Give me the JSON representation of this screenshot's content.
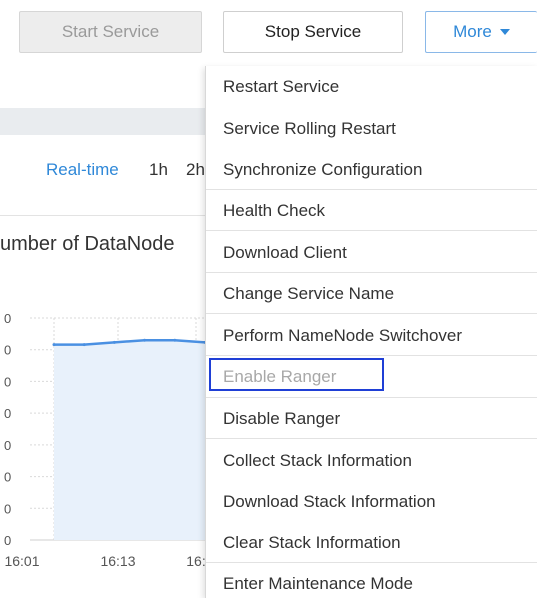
{
  "toolbar": {
    "start_label": "Start Service",
    "stop_label": "Stop Service",
    "more_label": "More"
  },
  "time_range": {
    "realtime": "Real-time",
    "h1": "1h",
    "h2": "2h"
  },
  "chart_title": "umber of DataNode",
  "chart_data": {
    "type": "area",
    "x_tick_labels": [
      "16:01",
      "16:13",
      "16:"
    ],
    "y_tick_labels": [
      "0",
      "0",
      "0",
      "0",
      "0",
      "0",
      "0",
      "0"
    ],
    "series": [
      {
        "values": [
          0.88,
          0.88,
          0.89,
          0.9,
          0.9,
          0.89
        ]
      }
    ],
    "ylim": [
      0,
      1
    ],
    "grid": true,
    "colors": {
      "line": "#4a90e2",
      "fill": "#e8f1fb"
    }
  },
  "menu": {
    "items": [
      {
        "label": "Restart Service"
      },
      {
        "label": "Service Rolling Restart"
      },
      {
        "label": "Synchronize Configuration"
      },
      {
        "label": "Health Check"
      },
      {
        "label": "Download Client"
      },
      {
        "label": "Change Service Name"
      },
      {
        "label": "Perform NameNode Switchover"
      },
      {
        "label": "Enable Ranger"
      },
      {
        "label": "Disable Ranger"
      },
      {
        "label": "Collect Stack Information"
      },
      {
        "label": "Download Stack Information"
      },
      {
        "label": "Clear Stack Information"
      },
      {
        "label": "Enter Maintenance Mode"
      }
    ]
  },
  "colors": {
    "accent": "#2f88d8",
    "focus": "#1f3fd6"
  }
}
